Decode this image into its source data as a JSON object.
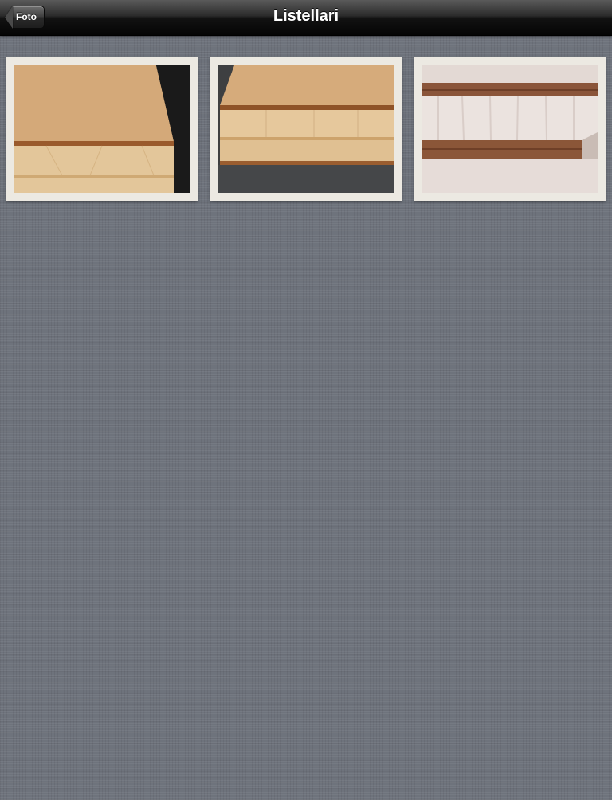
{
  "navbar": {
    "title": "Listellari",
    "back_label": "Foto"
  },
  "gallery": {
    "items": [
      {
        "icon": "photo-thumbnail-icon"
      },
      {
        "icon": "photo-thumbnail-icon"
      },
      {
        "icon": "photo-thumbnail-icon"
      }
    ]
  },
  "colors": {
    "background": "#6e737c",
    "navbar": "#121212",
    "frame": "#ece9e2"
  }
}
